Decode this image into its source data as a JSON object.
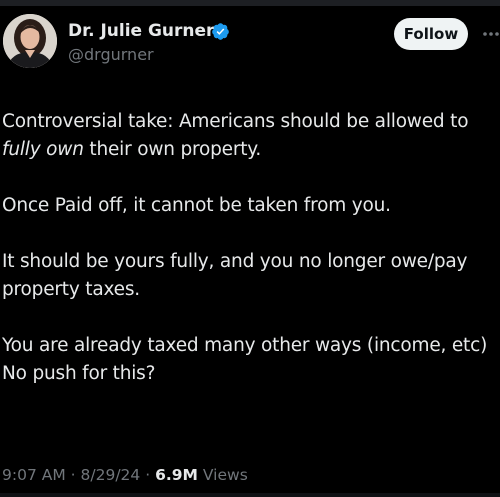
{
  "author": {
    "display_name": "Dr. Julie Gurner",
    "handle": "@drgurner",
    "verified": true
  },
  "actions": {
    "follow_label": "Follow",
    "more_icon": "more-horizontal-icon"
  },
  "tweet": {
    "line1_before": "Controversial take: Americans should be allowed to ",
    "line1_emphasis": "fully own",
    "line1_after": " their own property.",
    "para2": "Once Paid off, it cannot be taken from you.",
    "para3": "It should be yours fully, and you no longer owe/pay property taxes.",
    "para4_line1": "You are already taxed many other ways (income, etc)",
    "para4_line2": "No push for this?"
  },
  "meta": {
    "time": "9:07 AM",
    "date": "8/29/24",
    "views_count": "6.9M",
    "views_label": "Views"
  },
  "colors": {
    "background": "#000000",
    "text": "#e7e9ea",
    "secondary": "#71767b",
    "verified_badge": "#1d9bf0",
    "follow_bg": "#eff3f4"
  }
}
